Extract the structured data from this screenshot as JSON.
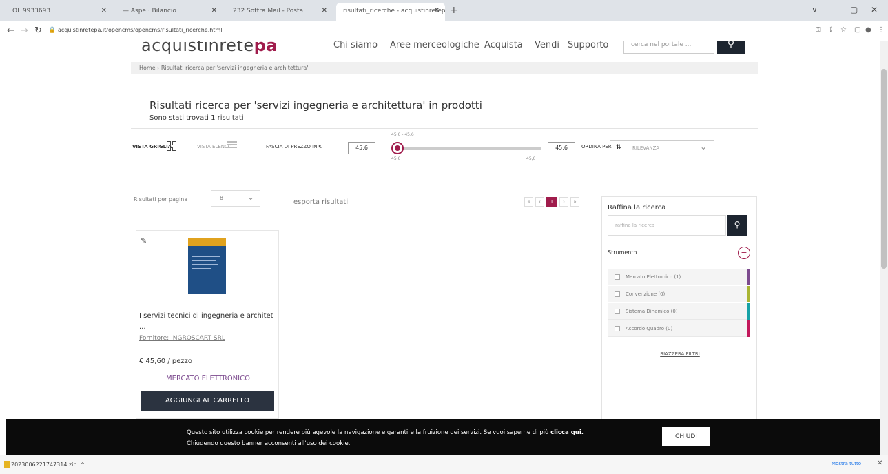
{
  "browser": {
    "tabs": [
      {
        "label": "OL 9933693"
      },
      {
        "label": "— Aspe · Bilancio"
      },
      {
        "label": "232 Sottra Mail - Posta"
      },
      {
        "label": "risultati_ricerche - acquistinretepa"
      }
    ],
    "new_tab": "+",
    "url": "acquistinretepa.it/opencms/opencms/risultati_ricerche.html",
    "window_controls": [
      "∨",
      "–",
      "▢",
      "✕"
    ]
  },
  "header": {
    "logo_main": "acquistinrete",
    "logo_accent": "pa",
    "nav": [
      "Chi siamo",
      "Aree merceologiche",
      "Acquista",
      "Vendi",
      "Supporto"
    ],
    "search_placeholder": "cerca nel portale ..."
  },
  "breadcrumb": "Home  ›  Risultati ricerca per 'servizi ingegneria e architettura'",
  "results": {
    "title": "Risultati ricerca per 'servizi ingegneria e architettura' in prodotti",
    "subtitle": "Sono stati trovati 1 risultati"
  },
  "toolbar": {
    "grid_view": "VISTA GRIGLIA",
    "list_view": "VISTA ELENCO",
    "price_range_label": "FASCIA DI PREZZO IN €",
    "price_min": "45,6",
    "price_max": "45,6",
    "slider_range": "45,6 - 45,6",
    "slider_min_label": "45,6",
    "slider_max_label": "45,6",
    "sort_label": "ORDINA PER",
    "sort_icon": "⇅",
    "sort_value": "RILEVANZA"
  },
  "list_controls": {
    "per_page_label": "Risultati per pagina",
    "per_page_value": "8",
    "export": "esporta risultati",
    "pager": [
      "«",
      "‹",
      "1",
      "›",
      "»"
    ]
  },
  "product": {
    "title": "I servizi tecnici di ingegneria e architet ...",
    "supplier": "Fornitore: INGROSCART SRL",
    "price": "€ 45,60 / pezzo",
    "market": "MERCATO ELETTRONICO",
    "cart_button": "AGGIUNGI AL CARRELLO",
    "cover_band_color": "#e0a21e",
    "cover_color": "#1f4f86"
  },
  "filters": {
    "title": "Raffina la ricerca",
    "placeholder": "raffina la ricerca",
    "section": "Strumento",
    "items": [
      {
        "label": "Mercato Elettronico (1)",
        "color": "#7d4b8f"
      },
      {
        "label": "Convenzione (0)",
        "color": "#a9b533"
      },
      {
        "label": "Sistema Dinamico (0)",
        "color": "#17a2a6"
      },
      {
        "label": "Accordo Quadro (0)",
        "color": "#c2185b"
      }
    ],
    "reset": "RIAZZERA FILTRI"
  },
  "cookie": {
    "line1": "Questo sito utilizza cookie per rendere più agevole la navigazione e garantire la fruizione dei servizi. Se vuoi saperne di più",
    "link": "clicca qui.",
    "line2": "Chiudendo questo banner acconsenti all'uso dei cookie.",
    "button": "CHIUDI"
  },
  "downloads": {
    "file": "2023006221747314.zip",
    "chevron": "^",
    "show_all": "Mostra tutto",
    "close": "✕"
  },
  "colors": {
    "accent": "#a01c4c",
    "dark_button": "#2b3340"
  }
}
